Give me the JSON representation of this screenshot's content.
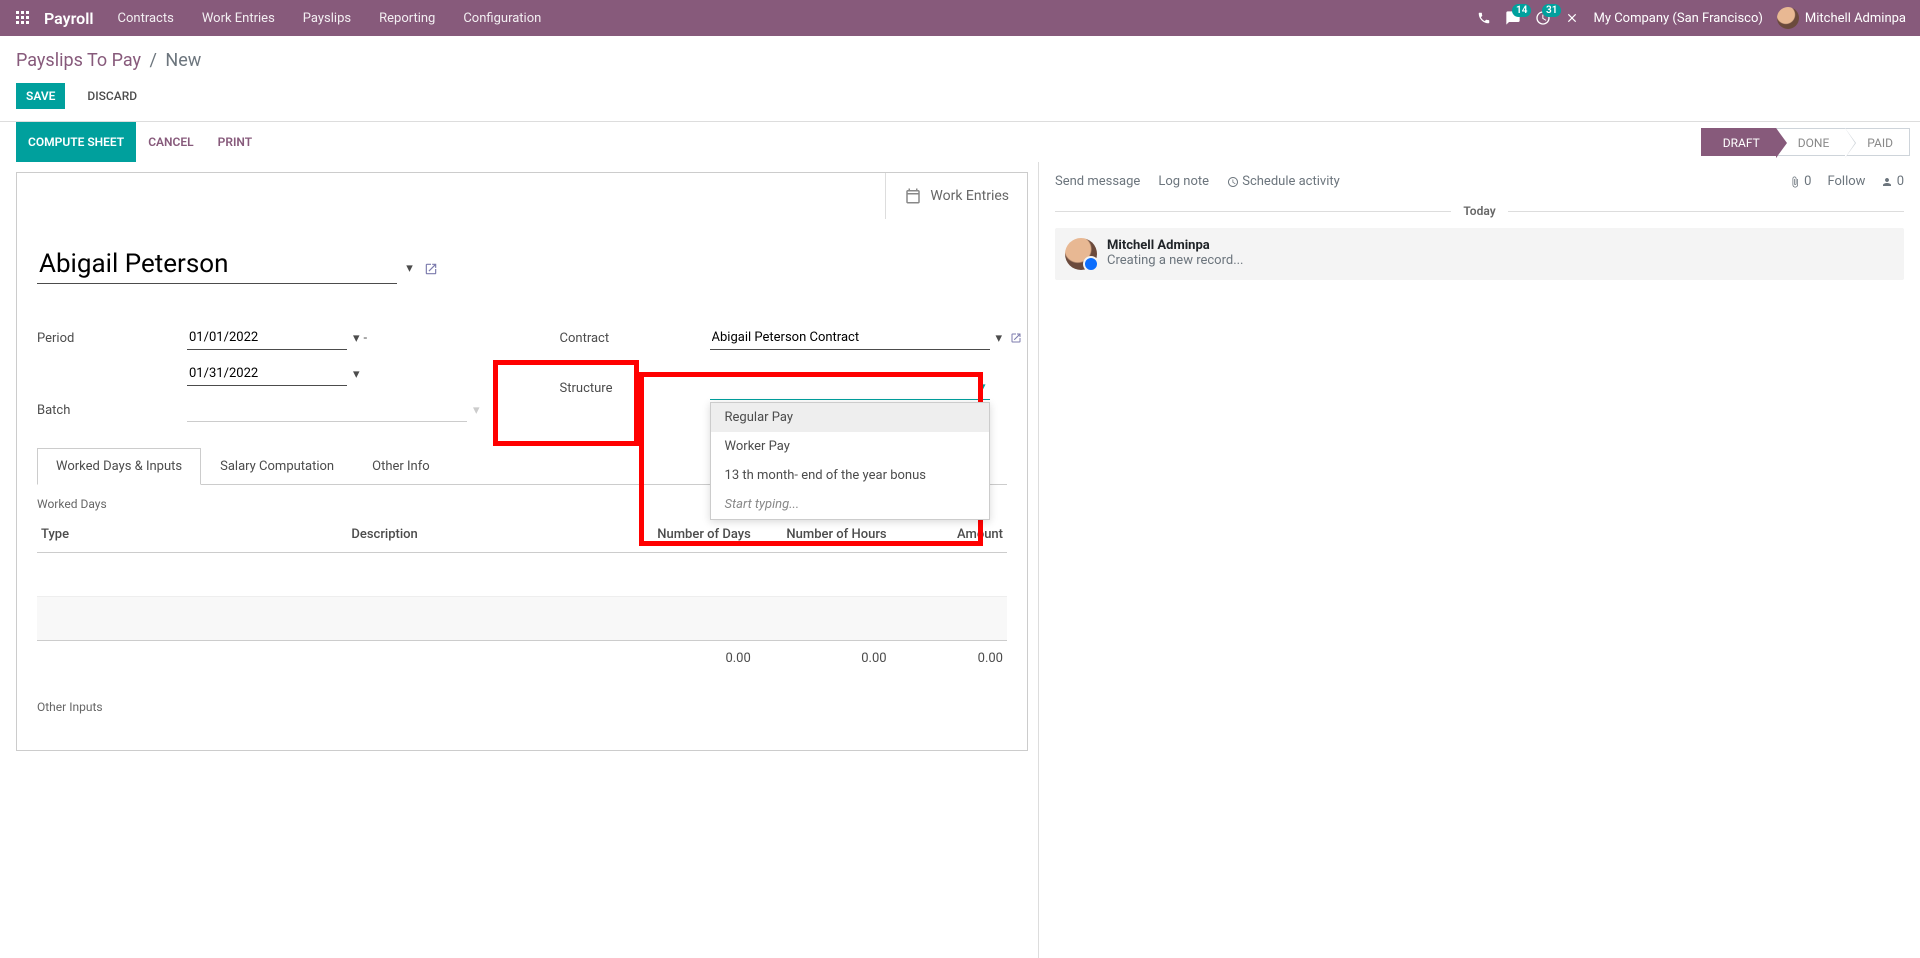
{
  "topbar": {
    "brand": "Payroll",
    "menu": [
      "Contracts",
      "Work Entries",
      "Payslips",
      "Reporting",
      "Configuration"
    ],
    "msg_badge": "14",
    "activity_badge": "31",
    "company": "My Company (San Francisco)",
    "user": "Mitchell Adminpa"
  },
  "breadcrumb": {
    "root": "Payslips To Pay",
    "current": "New"
  },
  "actions": {
    "save": "SAVE",
    "discard": "DISCARD"
  },
  "toolbar": {
    "compute": "COMPUTE SHEET",
    "cancel": "CANCEL",
    "print": "PRINT"
  },
  "status": {
    "draft": "DRAFT",
    "done": "DONE",
    "paid": "PAID"
  },
  "sheet": {
    "work_entries_btn": "Work Entries",
    "employee_name": "Abigail Peterson",
    "labels": {
      "period": "Period",
      "batch": "Batch",
      "contract": "Contract",
      "structure": "Structure"
    },
    "period_from": "01/01/2022",
    "period_to": "01/31/2022",
    "batch": "",
    "contract": "Abigail Peterson Contract",
    "structure": "",
    "tabs": [
      "Worked Days & Inputs",
      "Salary Computation",
      "Other Info"
    ],
    "worked_days_title": "Worked Days",
    "other_inputs_title": "Other Inputs",
    "columns": {
      "type": "Type",
      "description": "Description",
      "num_days": "Number of Days",
      "num_hours": "Number of Hours",
      "amount": "Amount"
    },
    "totals": {
      "days": "0.00",
      "hours": "0.00",
      "amount": "0.00"
    }
  },
  "dropdown": {
    "options": [
      "Regular Pay",
      "Worker Pay",
      "13 th month- end of the year bonus"
    ],
    "hint": "Start typing..."
  },
  "chatter": {
    "send": "Send message",
    "log": "Log note",
    "schedule": "Schedule activity",
    "attach_count": "0",
    "follow": "Follow",
    "follower_count": "0",
    "today": "Today",
    "msg_author": "Mitchell Adminpa",
    "msg_body": "Creating a new record..."
  }
}
